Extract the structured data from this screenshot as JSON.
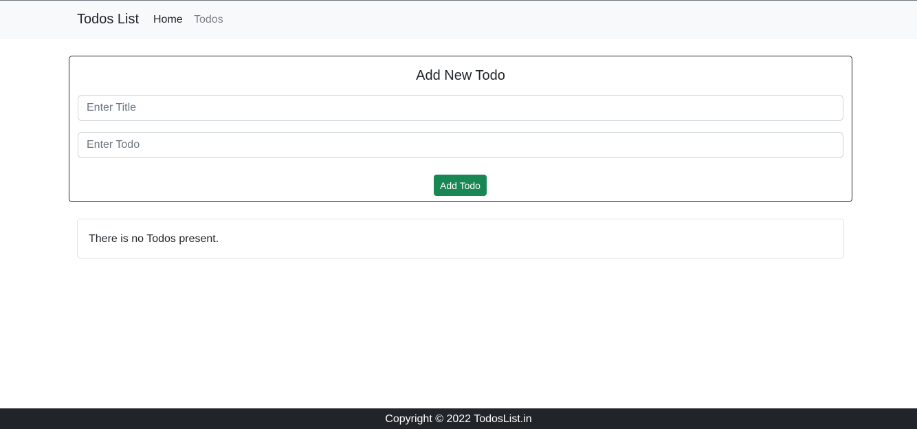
{
  "navbar": {
    "brand": "Todos List",
    "links": [
      {
        "label": "Home",
        "active": true
      },
      {
        "label": "Todos",
        "active": false
      }
    ]
  },
  "form": {
    "heading": "Add New Todo",
    "title_placeholder": "Enter Title",
    "title_value": "",
    "todo_placeholder": "Enter Todo",
    "todo_value": "",
    "submit_label": "Add Todo"
  },
  "todos": {
    "empty_message": "There is no Todos present."
  },
  "footer": {
    "copyright": "Copyright © 2022 TodosList.in"
  },
  "colors": {
    "navbar_bg": "#f8f9fa",
    "button_success": "#198754",
    "footer_bg": "#212529",
    "text_dark": "#212529",
    "text_muted": "#6c757d"
  }
}
